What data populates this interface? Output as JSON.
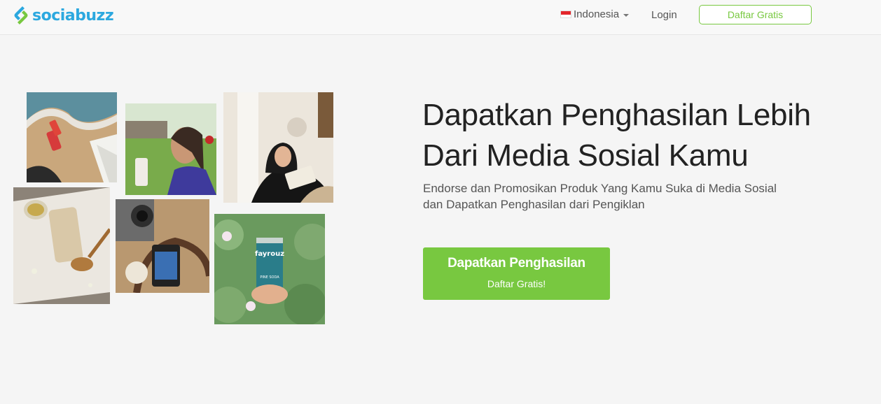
{
  "brand": {
    "name_part1": "socia",
    "name_part2": "buzz"
  },
  "nav": {
    "language": "Indonesia",
    "login_label": "Login",
    "signup_label": "Daftar Gratis"
  },
  "hero": {
    "headline_line1": "Dapatkan Penghasilan Lebih",
    "headline_line2": "Dari Media Sosial Kamu",
    "subtitle_line1": "Endorse dan Promosikan Produk Yang Kamu Suka di Media Sosial",
    "subtitle_line2": "dan Dapatkan Penghasilan dari Pengiklan",
    "cta_title": "Dapatkan Penghasilan",
    "cta_subtitle": "Daftar Gratis!"
  },
  "photos": {
    "can_label1": "fayrouz",
    "can_label2": "PINE SODA"
  },
  "colors": {
    "accent_green": "#78c840",
    "brand_blue": "#2ca8df"
  }
}
